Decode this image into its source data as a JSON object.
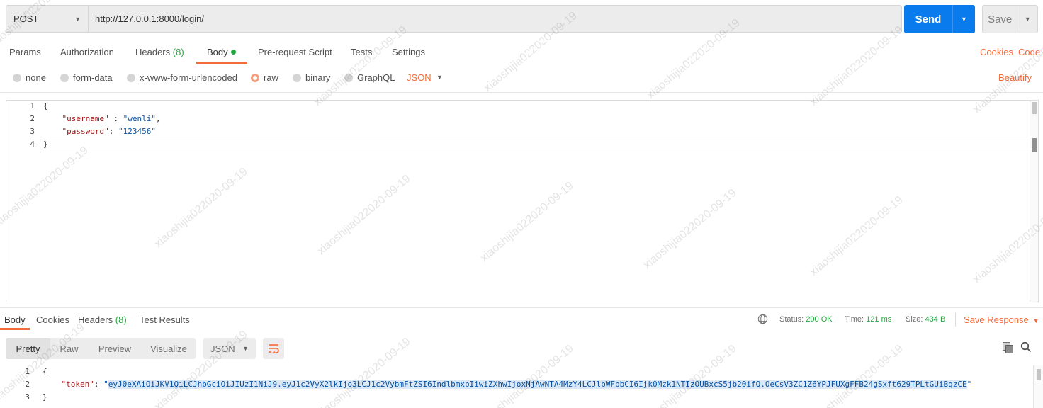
{
  "request": {
    "method": "POST",
    "url": "http://127.0.0.1:8000/login/",
    "send_label": "Send",
    "save_label": "Save"
  },
  "tabs": {
    "params": "Params",
    "authorization": "Authorization",
    "headers": "Headers",
    "headers_count": "(8)",
    "body": "Body",
    "prerequest": "Pre-request Script",
    "tests": "Tests",
    "settings": "Settings",
    "cookies": "Cookies",
    "code": "Code"
  },
  "body_types": {
    "none": "none",
    "form_data": "form-data",
    "urlencoded": "x-www-form-urlencoded",
    "raw": "raw",
    "binary": "binary",
    "graphql": "GraphQL",
    "format": "JSON",
    "beautify": "Beautify",
    "selected": "raw"
  },
  "request_body": {
    "line_numbers": [
      "1",
      "2",
      "3",
      "4"
    ],
    "lines": [
      {
        "text": "{"
      },
      {
        "key": "\"username\"",
        "sep": " : ",
        "value": "\"wenli\"",
        "tail": ","
      },
      {
        "key": "\"password\"",
        "sep": ": ",
        "value": "\"123456\"",
        "tail": ""
      },
      {
        "text": "}"
      }
    ]
  },
  "response_tabs": {
    "body": "Body",
    "cookies": "Cookies",
    "headers": "Headers",
    "headers_count": "(8)",
    "test_results": "Test Results"
  },
  "response_status": {
    "status_label": "Status:",
    "status_value": "200 OK",
    "time_label": "Time:",
    "time_value": "121 ms",
    "size_label": "Size:",
    "size_value": "434 B",
    "save_response": "Save Response"
  },
  "view_modes": {
    "pretty": "Pretty",
    "raw": "Raw",
    "preview": "Preview",
    "visualize": "Visualize",
    "format": "JSON"
  },
  "response_body": {
    "line_numbers": [
      "1",
      "2",
      "3"
    ],
    "open": "{",
    "token_key": "\"token\"",
    "token_sep": ": ",
    "token_quote_open": "\"",
    "token_value": "eyJ0eXAiOiJKV1QiLCJhbGciOiJIUzI1NiJ9.eyJ1c2VyX2lkIjo3LCJ1c2VybmFtZSI6IndlbmxpIiwiZXhwIjoxNjAwNTA4MzY4LCJlbWFpbCI6Ijk0Mzk1NTIzOUBxcS5jb20ifQ.OeCsV3ZC1Z6YPJFUXgFFB24gSxft629TPLtGUiBqzCE",
    "token_quote_close": "\"",
    "close": "}"
  },
  "watermark": "xiaoshijia022020-09-19",
  "colors": {
    "accent": "#f26b3a",
    "send": "#097bed",
    "success": "#26a541"
  }
}
